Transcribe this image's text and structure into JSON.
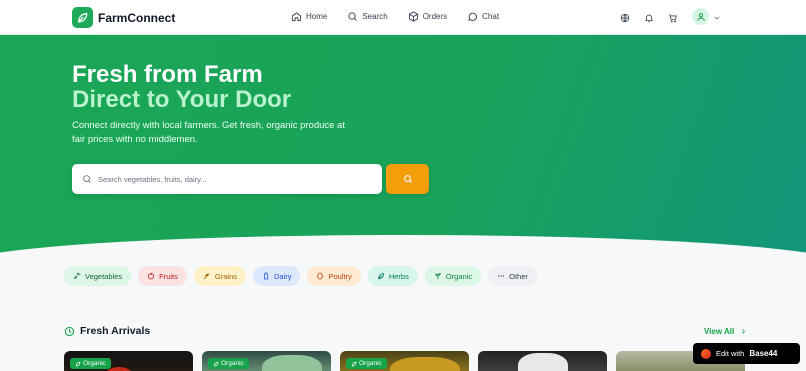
{
  "app": {
    "name": "FarmConnect",
    "brand_color": "#1faa5a"
  },
  "nav": {
    "items": [
      {
        "label": "Home",
        "icon": "home-icon"
      },
      {
        "label": "Search",
        "icon": "search-icon"
      },
      {
        "label": "Orders",
        "icon": "box-icon"
      },
      {
        "label": "Chat",
        "icon": "chat-icon"
      }
    ],
    "actions": [
      "globe-icon",
      "bell-icon",
      "cart-icon",
      "user-icon",
      "chevron-down-icon"
    ]
  },
  "hero": {
    "title_line1": "Fresh from Farm",
    "title_line2": "Direct to Your Door",
    "subtitle": "Connect directly with local farmers. Get fresh, organic produce at fair prices with no middlemen.",
    "search_placeholder": "Search vegetables, fruits, dairy..."
  },
  "categories": [
    {
      "label": "Vegetables",
      "bg": "#dcf7e6",
      "fg": "#166534",
      "icon": "carrot-icon"
    },
    {
      "label": "Fruits",
      "bg": "#fde2e2",
      "fg": "#b91c1c",
      "icon": "apple-icon"
    },
    {
      "label": "Grains",
      "bg": "#fdf1c7",
      "fg": "#a16207",
      "icon": "wheat-icon"
    },
    {
      "label": "Dairy",
      "bg": "#dde8fd",
      "fg": "#1d4ed8",
      "icon": "milk-icon"
    },
    {
      "label": "Poultry",
      "bg": "#feead2",
      "fg": "#c2410c",
      "icon": "egg-icon"
    },
    {
      "label": "Herbs",
      "bg": "#d8f6ec",
      "fg": "#047857",
      "icon": "leaf-icon"
    },
    {
      "label": "Organic",
      "bg": "#dcf7e6",
      "fg": "#15803d",
      "icon": "sprout-icon"
    },
    {
      "label": "Other",
      "bg": "#eef0f3",
      "fg": "#374151",
      "icon": "more-icon"
    }
  ],
  "fresh": {
    "title": "Fresh Arrivals",
    "view_all": "View All",
    "cards": [
      {
        "badge": "Organic",
        "bg": "#1a1a1a"
      },
      {
        "badge": "Organic",
        "bg": "#3a5a4a"
      },
      {
        "badge": "Organic",
        "bg": "#6b5a1e"
      },
      {
        "badge": "",
        "bg": "#3b3b3b"
      },
      {
        "badge": "",
        "bg": "#8a8f6a"
      }
    ]
  },
  "edit_pill": {
    "prefix": "Edit with",
    "brand": "Base44"
  }
}
